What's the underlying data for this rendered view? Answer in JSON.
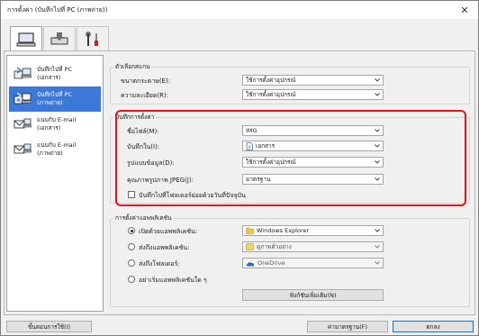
{
  "window": {
    "title": "การตั้งค่า (บันทึกไปที่ PC (ภาพถ่าย))",
    "close_glyph": "✕"
  },
  "top_tabs": [
    {
      "icon": "computer-icon"
    },
    {
      "icon": "scanner-icon"
    },
    {
      "icon": "tools-icon"
    }
  ],
  "sidebar": {
    "items": [
      {
        "label_line1": "บันทึกไปที่ PC",
        "label_line2": "(เอกสาร)",
        "icon": "save-to-pc-icon"
      },
      {
        "label_line1": "บันทึกไปที่ PC",
        "label_line2": "(ภาพถ่าย)",
        "icon": "save-to-pc-icon",
        "selected": true
      },
      {
        "label_line1": "แนบกับ E-mail",
        "label_line2": "(เอกสาร)",
        "icon": "email-attach-icon"
      },
      {
        "label_line1": "แนบกับ E-mail",
        "label_line2": "(ภาพถ่าย)",
        "icon": "email-attach-icon"
      }
    ]
  },
  "scan_options": {
    "title": "ตัวเลือกสแกน",
    "paper_size_label": "ขนาดกระดาษ(E):",
    "paper_size_value": "ใช้การตั้งค่าอุปกรณ์",
    "resolution_label": "ความละเอียด(R):",
    "resolution_value": "ใช้การตั้งค่าอุปกรณ์"
  },
  "save_settings": {
    "title": "บันทึกการตั้งค่า",
    "filename_label": "ชื่อไฟล์(M):",
    "filename_value": "IMG",
    "save_in_label": "บันทึกใน(I):",
    "save_in_value": "เอกสาร",
    "data_format_label": "รูปแบบข้อมูล(D):",
    "data_format_value": "ใช้การตั้งค่าอุปกรณ์",
    "jpeg_quality_label": "คุณภาพรูปภาพ JPEG(J):",
    "jpeg_quality_value": "มาตรฐาน",
    "subfolder_label": "บันทึกไปที่โฟลเดอร์ย่อยด้วยวันที่ปัจจุบัน"
  },
  "app_settings": {
    "title": "การตั้งค่าแอพพลิเคชัน",
    "open_app_label": "เปิดด้วยแอพพลิเคชัน:",
    "open_app_value": "Windows Explorer",
    "send_app_label": "ส่งถึงแอพพลิเคชัน:",
    "send_app_value": "ดูภาพตัวอย่าง",
    "send_folder_label": "ส่งถึงโฟลเดอร์:",
    "send_folder_value": "OneDrive",
    "no_app_label": "อย่าเริ่มแอพพลิเคชันใด ๆ",
    "more_functions_label": "ฟังก์ชันเพิ่มเติม(N)"
  },
  "footer": {
    "instructions_label": "ขั้นตอนการใช้(I)",
    "defaults_label": "ค่ามาตรฐาน(F)",
    "ok_label": "ตกลง"
  }
}
